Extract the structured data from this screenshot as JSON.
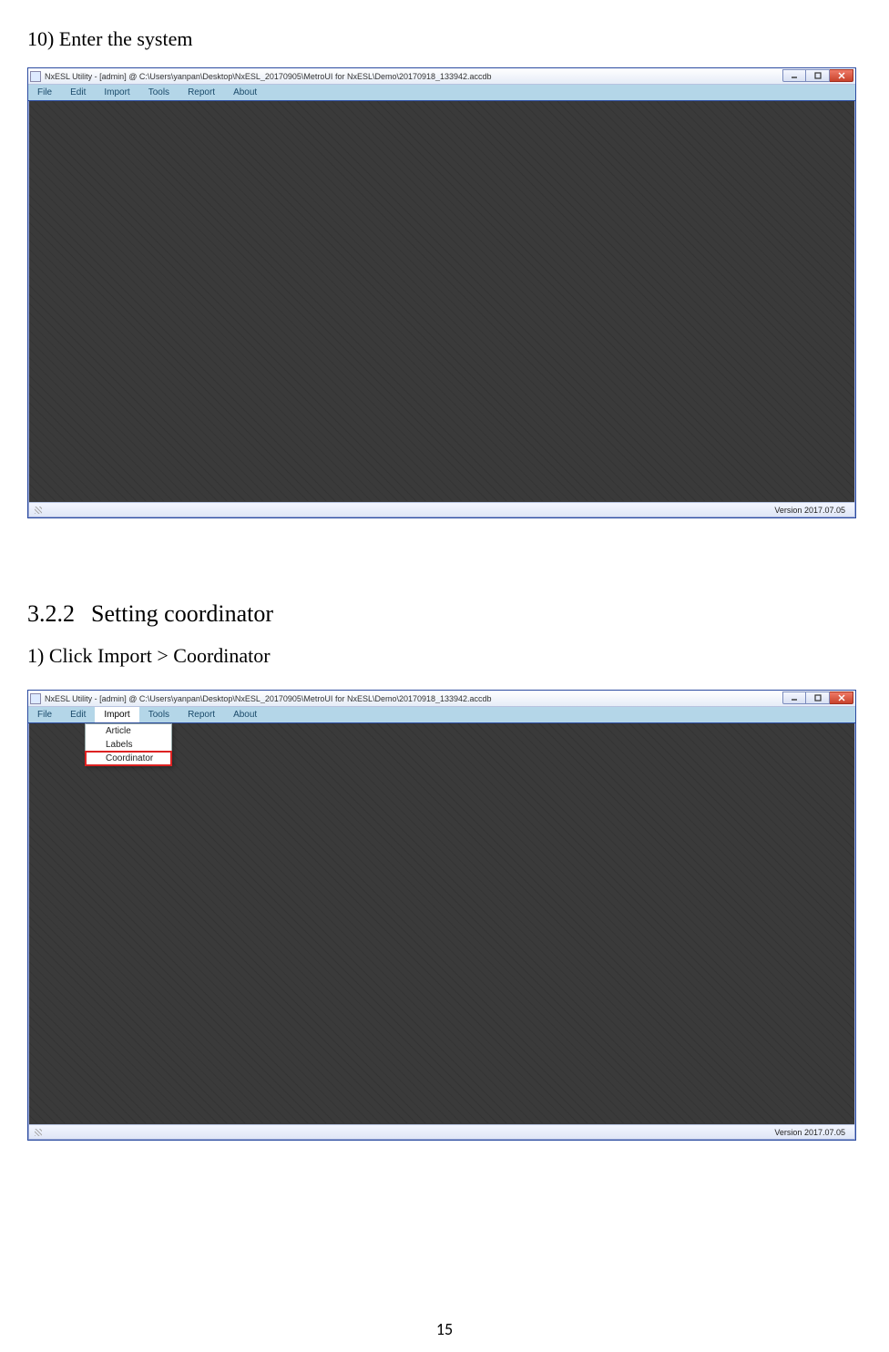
{
  "doc": {
    "step10": "10)  Enter the system",
    "section_num": "3.2.2",
    "section_title": "Setting coordinator",
    "step1": "1) Click Import > Coordinator",
    "page_number": "15"
  },
  "window": {
    "title": "NxESL Utility - [admin] @ C:\\Users\\yanpan\\Desktop\\NxESL_20170905\\MetroUI for NxESL\\Demo\\20170918_133942.accdb",
    "menus": {
      "file": "File",
      "edit": "Edit",
      "import": "Import",
      "tools": "Tools",
      "report": "Report",
      "about": "About"
    },
    "version": "Version 2017.07.05",
    "dropdown": {
      "article": "Article",
      "labels": "Labels",
      "coordinator": "Coordinator"
    }
  }
}
